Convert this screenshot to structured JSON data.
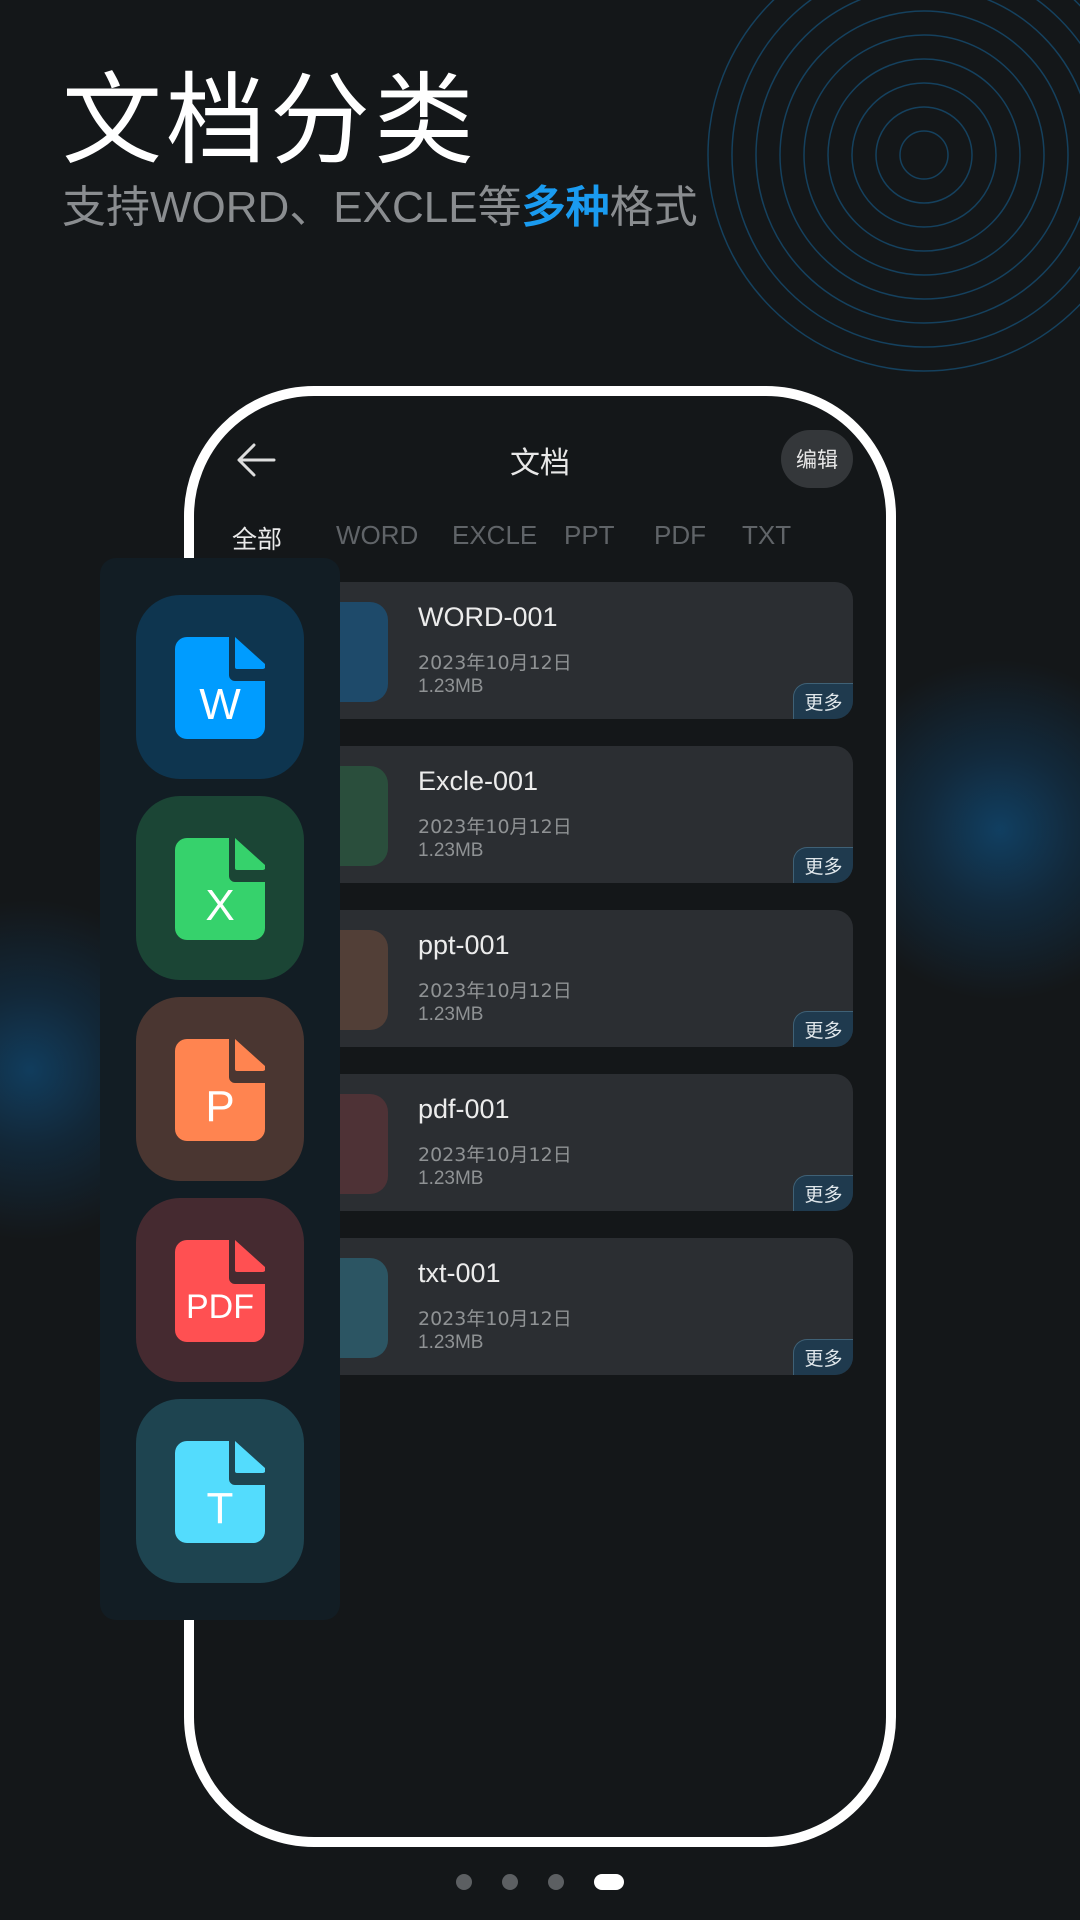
{
  "headline": {
    "title": "文档分类",
    "subtitle_pre": "支持WORD、EXCLE等",
    "subtitle_highlight": "多种",
    "subtitle_post": "格式",
    "highlight_color": "#1a9bf0"
  },
  "app": {
    "title": "文档",
    "edit_label": "编辑",
    "back_icon": "arrow-left-icon",
    "tabs": [
      {
        "label": "全部",
        "active": true
      },
      {
        "label": "WORD"
      },
      {
        "label": "EXCLE"
      },
      {
        "label": "PPT"
      },
      {
        "label": "PDF"
      },
      {
        "label": "TXT"
      }
    ],
    "files": [
      {
        "name": "WORD-001",
        "date": "2023年10月12日",
        "size": "1.23MB",
        "more": "更多",
        "color": "#1e4a6a"
      },
      {
        "name": "Excle-001",
        "date": "2023年10月12日",
        "size": "1.23MB",
        "more": "更多",
        "color": "#2a4e3c"
      },
      {
        "name": "ppt-001",
        "date": "2023年10月12日",
        "size": "1.23MB",
        "more": "更多",
        "color": "#523f37"
      },
      {
        "name": "pdf-001",
        "date": "2023年10月12日",
        "size": "1.23MB",
        "more": "更多",
        "color": "#4e3236"
      },
      {
        "name": "txt-001",
        "date": "2023年10月12日",
        "size": "1.23MB",
        "more": "更多",
        "color": "#2c5563"
      }
    ]
  },
  "file_types": [
    {
      "letter": "W",
      "tile": "#0e354f",
      "icon": "#009cff",
      "name": "word-file-icon"
    },
    {
      "letter": "X",
      "tile": "#1b4535",
      "icon": "#36d26c",
      "name": "excel-file-icon"
    },
    {
      "letter": "P",
      "tile": "#4a3631",
      "icon": "#ff8450",
      "name": "ppt-file-icon"
    },
    {
      "letter": "PDF",
      "tile": "#452a30",
      "icon": "#ff5052",
      "name": "pdf-file-icon"
    },
    {
      "letter": "T",
      "tile": "#1e4450",
      "icon": "#53dcfd",
      "name": "txt-file-icon"
    }
  ],
  "pager": {
    "count": 4,
    "active": 4
  }
}
